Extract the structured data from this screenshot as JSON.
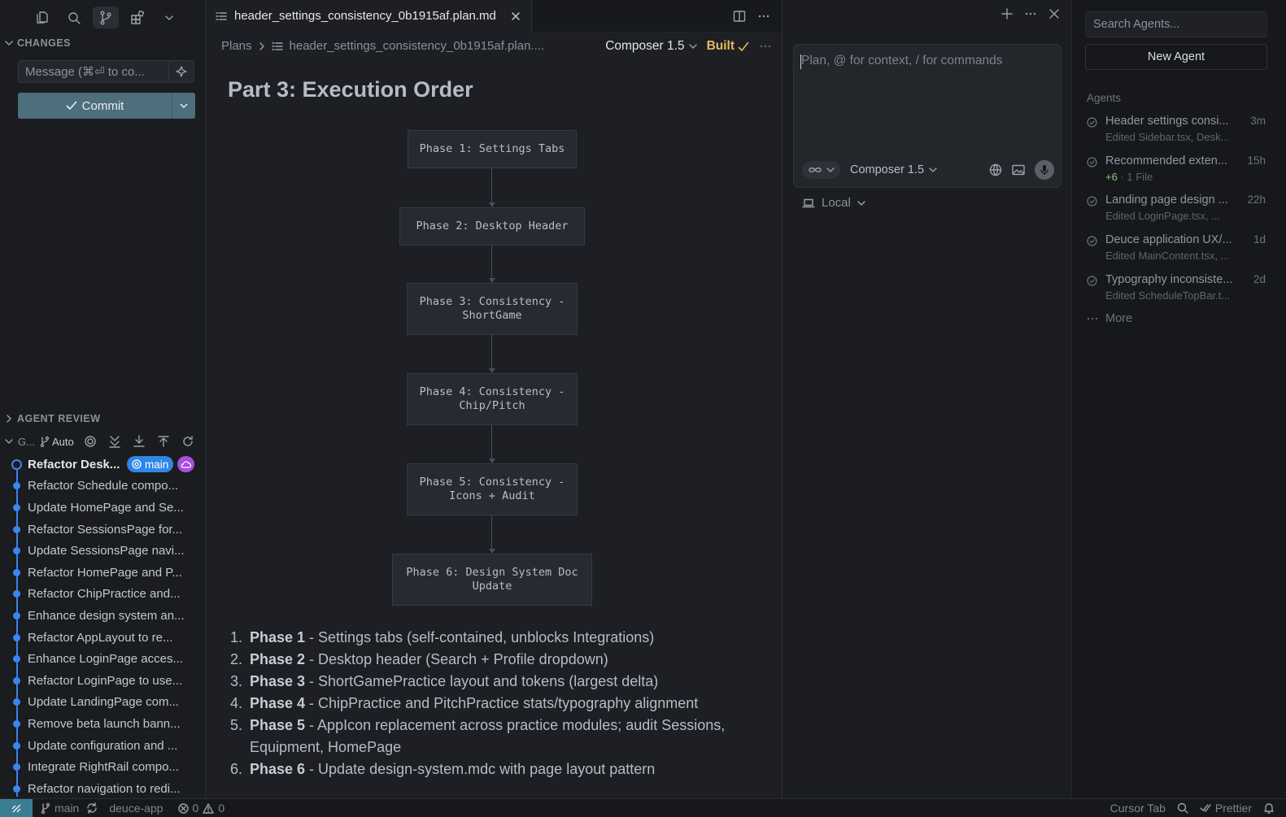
{
  "left": {
    "changes_label": "CHANGES",
    "message_placeholder": "Message (⌘⏎ to co...",
    "commit_label": "Commit",
    "agent_review_label": "AGENT REVIEW",
    "graph_label": "G...",
    "auto_label": "Auto",
    "branch_badge": "main",
    "commits": [
      "Refactor Desk...",
      "Refactor Schedule compo...",
      "Update HomePage and Se...",
      "Refactor SessionsPage for...",
      "Update SessionsPage navi...",
      "Refactor HomePage and P...",
      "Refactor ChipPractice and...",
      "Enhance design system an...",
      "Refactor AppLayout to re...",
      "Enhance LoginPage acces...",
      "Refactor LoginPage to use...",
      "Update LandingPage com...",
      "Remove beta launch bann...",
      "Update configuration and ...",
      "Integrate RightRail compo...",
      "Refactor navigation to redi..."
    ]
  },
  "editor": {
    "tab_title": "header_settings_consistency_0b1915af.plan.md",
    "breadcrumb_root": "Plans",
    "breadcrumb_file": "header_settings_consistency_0b1915af.plan....",
    "model": "Composer 1.5",
    "built_label": "Built",
    "heading": "Part 3: Execution Order",
    "phases": [
      {
        "line1": "Phase 1: Settings Tabs",
        "line2": ""
      },
      {
        "line1": "Phase 2: Desktop Header",
        "line2": ""
      },
      {
        "line1": "Phase 3: Consistency -",
        "line2": "ShortGame"
      },
      {
        "line1": "Phase 4: Consistency -",
        "line2": "Chip/Pitch"
      },
      {
        "line1": "Phase 5: Consistency -",
        "line2": "Icons + Audit"
      },
      {
        "line1": "Phase 6: Design System Doc",
        "line2": "Update"
      }
    ],
    "list": [
      {
        "num": "1.",
        "bold": "Phase 1",
        "text": " - Settings tabs (self-contained, unblocks Integrations)"
      },
      {
        "num": "2.",
        "bold": "Phase 2",
        "text": " - Desktop header (Search + Profile dropdown)"
      },
      {
        "num": "3.",
        "bold": "Phase 3",
        "text": " - ShortGamePractice layout and tokens (largest delta)"
      },
      {
        "num": "4.",
        "bold": "Phase 4",
        "text": " - ChipPractice and PitchPractice stats/typography alignment"
      },
      {
        "num": "5.",
        "bold": "Phase 5",
        "text": " - AppIcon replacement across practice modules; audit Sessions, Equipment, HomePage"
      },
      {
        "num": "6.",
        "bold": "Phase 6",
        "text": " - Update design-system.mdc with page layout pattern"
      }
    ]
  },
  "composer": {
    "placeholder": "Plan, @ for context, / for commands",
    "model": "Composer 1.5",
    "location": "Local"
  },
  "agents": {
    "search_placeholder": "Search Agents...",
    "new_agent": "New Agent",
    "label": "Agents",
    "items": [
      {
        "title": "Header settings consi...",
        "time": "3m",
        "plus": "",
        "sub": "Edited Sidebar.tsx, Desk..."
      },
      {
        "title": "Recommended exten...",
        "time": "15h",
        "plus": "+6",
        "sub": "· 1 File"
      },
      {
        "title": "Landing page design ...",
        "time": "22h",
        "plus": "",
        "sub": "Edited LoginPage.tsx, ..."
      },
      {
        "title": "Deuce application UX/...",
        "time": "1d",
        "plus": "",
        "sub": "Edited MainContent.tsx, ..."
      },
      {
        "title": "Typography inconsiste...",
        "time": "2d",
        "plus": "",
        "sub": "Edited ScheduleTopBar.t..."
      }
    ],
    "more": "More"
  },
  "status": {
    "branch": "main",
    "project": "deuce-app",
    "errors": "0",
    "warnings": "0",
    "cursor_tab": "Cursor Tab",
    "prettier": "Prettier"
  },
  "colors": {
    "accent": "#3a86f0",
    "commit": "#4d6e7d",
    "built": "#e8b85a",
    "branch_badge": "#2f86e8",
    "cloud_badge": "#a64ee0"
  }
}
